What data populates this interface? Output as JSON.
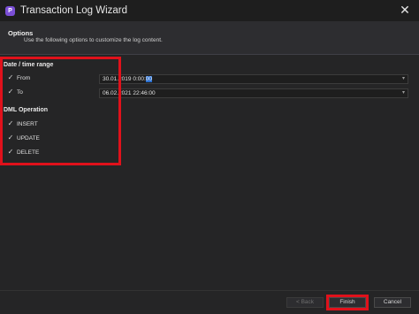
{
  "window": {
    "title": "Transaction Log Wizard"
  },
  "header": {
    "title": "Options",
    "description": "Use the following options to customize the log content."
  },
  "date_time_range": {
    "title": "Date / time range",
    "from": {
      "label": "From",
      "checked": true,
      "value_prefix": "30.01.2019 0:00:",
      "value_selected": "00"
    },
    "to": {
      "label": "To",
      "checked": true,
      "value": "06.02.2021 22:46:00"
    }
  },
  "dml_operation": {
    "title": "DML Operation",
    "items": [
      {
        "label": "INSERT",
        "checked": true
      },
      {
        "label": "UPDATE",
        "checked": true
      },
      {
        "label": "DELETE",
        "checked": true
      }
    ]
  },
  "buttons": {
    "back": "< Back",
    "finish": "Finish",
    "cancel": "Cancel"
  },
  "colors": {
    "highlight": "#e0111b",
    "accent": "#7b4fd6"
  }
}
